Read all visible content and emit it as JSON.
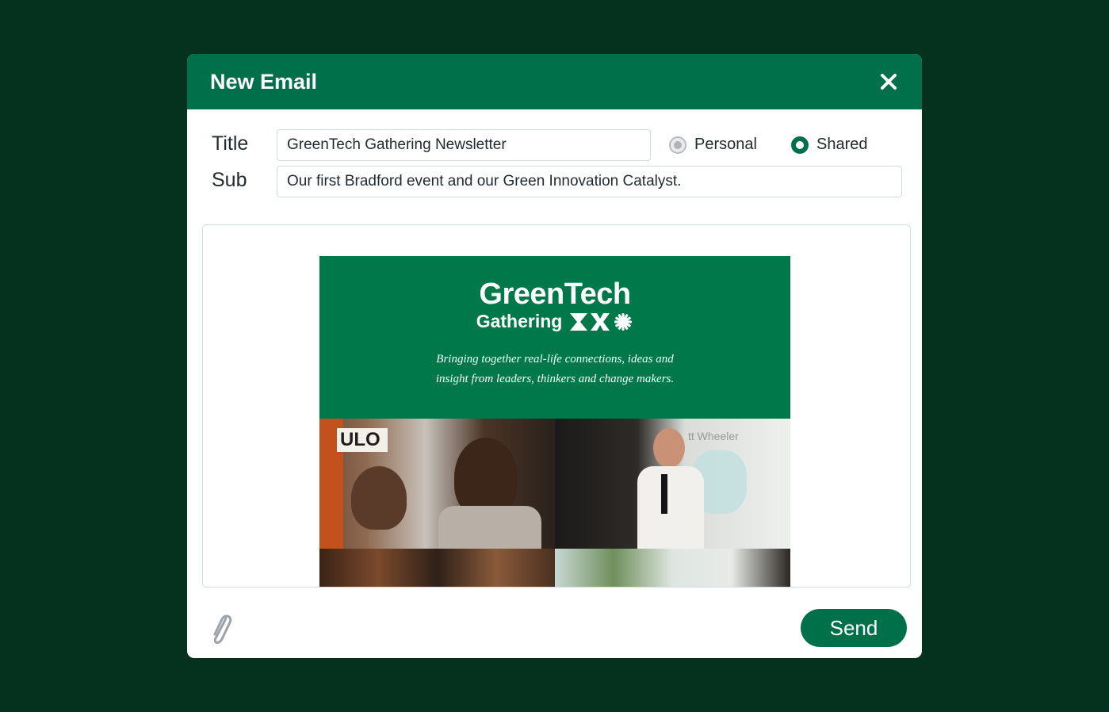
{
  "window": {
    "title": "New Email"
  },
  "form": {
    "title_label": "Title",
    "title_value": "GreenTech Gathering Newsletter",
    "sub_label": "Sub",
    "sub_value": "Our first Bradford event and our Green Innovation Catalyst.",
    "visibility_options": [
      {
        "label": "Personal",
        "selected": false
      },
      {
        "label": "Shared",
        "selected": true
      }
    ]
  },
  "newsletter": {
    "brand_line1": "GreenTech",
    "brand_line2": "Gathering",
    "tagline": "Bringing together real-life connections, ideas and insight from leaders, thinkers and change makers.",
    "photo_signage_1": "ULO",
    "photo_signage_2": "tt Wheeler"
  },
  "footer": {
    "send_label": "Send"
  },
  "colors": {
    "page_background": "#05321f",
    "accent": "#00704a",
    "banner": "#00784a"
  },
  "icons": [
    "close-icon",
    "paperclip-icon",
    "radio-icon",
    "brand-mark-icon"
  ]
}
